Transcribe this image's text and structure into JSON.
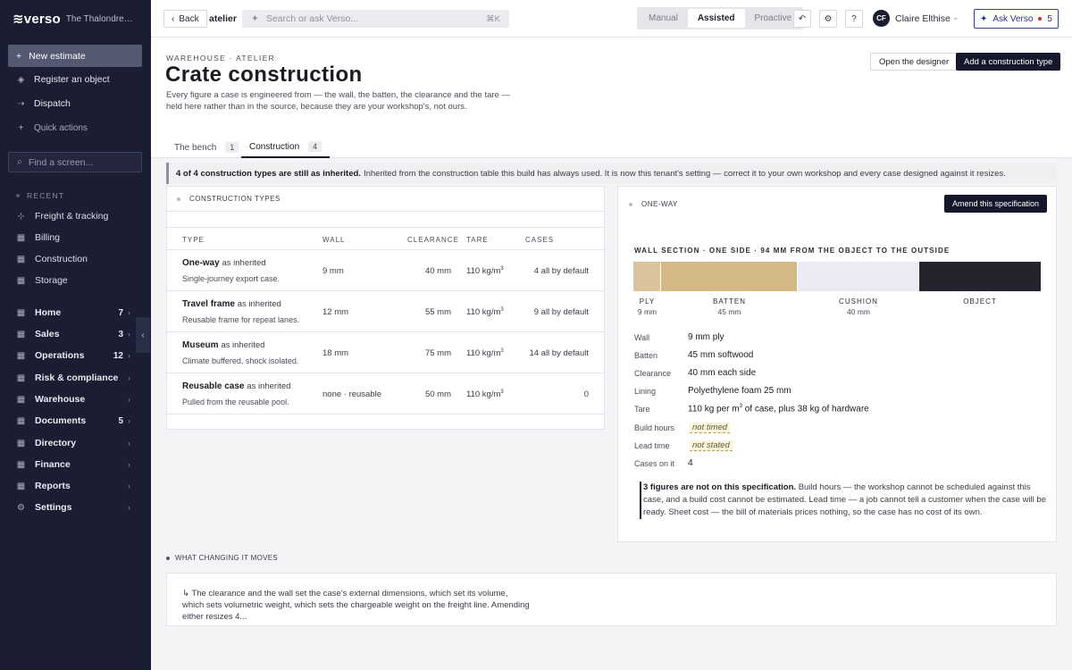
{
  "sidebar": {
    "brand": "verso",
    "org": "The Thalondre Archive",
    "new_estimate": "New estimate",
    "register_object": "Register an object",
    "dispatch": "Dispatch",
    "quick_actions": "Quick actions",
    "find_placeholder": "Find a screen...",
    "recent_label": "RECENT",
    "recent": [
      "Freight & tracking",
      "Billing",
      "Construction",
      "Storage"
    ],
    "nav": [
      {
        "label": "Home",
        "count": "7"
      },
      {
        "label": "Sales",
        "count": "3"
      },
      {
        "label": "Operations",
        "count": "12"
      },
      {
        "label": "Risk & compliance",
        "count": ""
      },
      {
        "label": "Warehouse",
        "count": ""
      },
      {
        "label": "Documents",
        "count": "5"
      },
      {
        "label": "Directory",
        "count": ""
      },
      {
        "label": "Finance",
        "count": ""
      },
      {
        "label": "Reports",
        "count": ""
      },
      {
        "label": "Settings",
        "count": ""
      }
    ]
  },
  "topbar": {
    "back": "Back",
    "crumb": "atelier",
    "search_placeholder": "Search or ask Verso...",
    "search_kbd": "⌘K",
    "modes": [
      "Manual",
      "Assisted",
      "Proactive"
    ],
    "active_mode": "Assisted",
    "user_initials": "CF",
    "user_name": "Claire Elthise",
    "ask_label": "Ask Verso",
    "ask_count": "5"
  },
  "header": {
    "eyebrow": "WAREHOUSE · ATELIER",
    "title": "Crate construction",
    "description": "Every figure a case is engineered from — the wall, the batten, the clearance and the tare — held here rather than in the source, because they are your workshop's, not ours.",
    "open_designer": "Open the designer",
    "add_type": "Add a construction type"
  },
  "tabs": [
    {
      "label": "The bench",
      "count": "1"
    },
    {
      "label": "Construction",
      "count": "4"
    }
  ],
  "notice": {
    "bold": "4 of 4 construction types are still as inherited.",
    "text": "Inherited from the construction table this build has always used. It is now this tenant's setting — correct it to your own workshop and every case designed against it resizes."
  },
  "types_panel": {
    "label": "CONSTRUCTION TYPES",
    "columns": [
      "TYPE",
      "WALL",
      "CLEARANCE",
      "TARE",
      "CASES"
    ],
    "rows": [
      {
        "name": "One-way",
        "inh": "as inherited",
        "sub": "Single-journey export case.",
        "wall": "9 mm",
        "clearance": "40 mm",
        "tare": "110 kg/m",
        "sup": "3",
        "cases": "4 all by default"
      },
      {
        "name": "Travel frame",
        "inh": "as inherited",
        "sub": "Reusable frame for repeat lanes.",
        "wall": "12 mm",
        "clearance": "55 mm",
        "tare": "110 kg/m",
        "sup": "3",
        "cases": "9 all by default"
      },
      {
        "name": "Museum",
        "inh": "as inherited",
        "sub": "Climate buffered, shock isolated.",
        "wall": "18 mm",
        "clearance": "75 mm",
        "tare": "110 kg/m",
        "sup": "3",
        "cases": "14 all by default"
      },
      {
        "name": "Reusable case",
        "inh": "as inherited",
        "sub": "Pulled from the reusable pool.",
        "wall": "none · reusable",
        "clearance": "50 mm",
        "tare": "110 kg/m",
        "sup": "3",
        "cases": "0"
      }
    ]
  },
  "detail": {
    "label": "ONE-WAY",
    "amend": "Amend this specification",
    "section_title": "WALL SECTION · ONE SIDE · 94 MM FROM THE OBJECT TO THE OUTSIDE",
    "segments": [
      {
        "name": "PLY",
        "mm": "9 mm",
        "value": 9,
        "color": "#d9c39a"
      },
      {
        "name": "BATTEN",
        "mm": "45 mm",
        "value": 45,
        "color": "#d4b987"
      },
      {
        "name": "CUSHION",
        "mm": "40 mm",
        "value": 40,
        "color": "#ecebf3"
      },
      {
        "name": "OBJECT",
        "mm": "",
        "value": 40,
        "color": "#23242e"
      }
    ],
    "specs": [
      {
        "label": "Wall",
        "value": "9 mm ply"
      },
      {
        "label": "Batten",
        "value": "45 mm softwood"
      },
      {
        "label": "Clearance",
        "value": "40 mm each side"
      },
      {
        "label": "Lining",
        "value": "Polyethylene foam 25 mm"
      },
      {
        "label": "Tare",
        "value": "110 kg per m",
        "sup": "3",
        "tail": " of case, plus 38 kg of hardware"
      },
      {
        "label": "Build hours",
        "value": "not timed",
        "missing": true
      },
      {
        "label": "Lead time",
        "value": "not stated",
        "missing": true
      },
      {
        "label": "Cases on it",
        "value": "4"
      }
    ],
    "note_bold": "3 figures are not on this specification.",
    "note_text": "Build hours — the workshop cannot be scheduled against this case, and a build cost cannot be estimated. Lead time — a job cannot tell a customer when the case will be ready. Sheet cost — the bill of materials prices nothing, so the case has no cost of its own."
  },
  "bottom": {
    "label": "WHAT CHANGING IT MOVES",
    "text": "↳ The clearance and the wall set the case's external dimensions, which set its volume, which sets volumetric weight, which sets the chargeable weight on the freight line. Amending either resizes 4..."
  }
}
